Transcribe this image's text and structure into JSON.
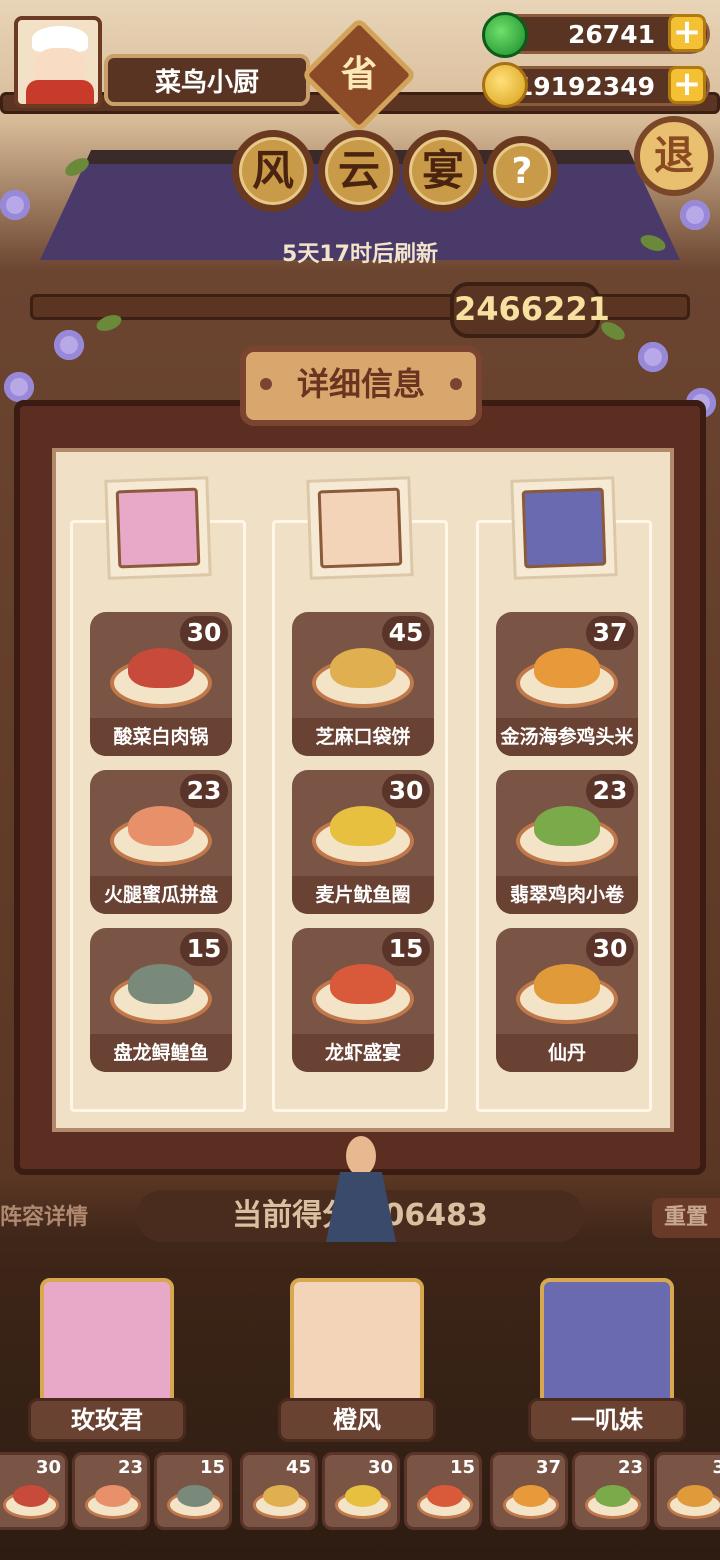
{
  "player": {
    "name": "菜鸟小厨",
    "badge": "省"
  },
  "resources": {
    "jade": "26741",
    "coins": "19192349"
  },
  "exit_label": "退",
  "event": {
    "title_chars": [
      "风",
      "云",
      "宴"
    ],
    "help": "?",
    "refresh_text": "5天17时后刷新",
    "top_score": "2466221"
  },
  "panel": {
    "header": "详细信息",
    "columns": [
      {
        "chef_color": "#e8a8c8",
        "dishes": [
          {
            "name": "酸菜白肉锅",
            "count": "30",
            "food": "#c84a3a"
          },
          {
            "name": "火腿蜜瓜拼盘",
            "count": "23",
            "food": "#e8906a"
          },
          {
            "name": "盘龙鲟鳇鱼",
            "count": "15",
            "food": "#7a8a7a"
          }
        ]
      },
      {
        "chef_color": "#f4d4b8",
        "dishes": [
          {
            "name": "芝麻口袋饼",
            "count": "45",
            "food": "#e0b050"
          },
          {
            "name": "麦片鱿鱼圈",
            "count": "30",
            "food": "#e8c040"
          },
          {
            "name": "龙虾盛宴",
            "count": "15",
            "food": "#d85a3a"
          }
        ]
      },
      {
        "chef_color": "#6a6ab0",
        "dishes": [
          {
            "name": "金汤海参鸡头米",
            "count": "37",
            "food": "#e89a3a"
          },
          {
            "name": "翡翠鸡肉小卷",
            "count": "23",
            "food": "#7aaa4a"
          },
          {
            "name": "仙丹",
            "count": "30",
            "food": "#e09a3a"
          }
        ]
      }
    ]
  },
  "bottom": {
    "current_score": "当前得分 306483",
    "lineup_label": "阵容详情",
    "reset_label": "重置",
    "chefs": [
      {
        "name": "玫玫君",
        "color": "#e8a8c8"
      },
      {
        "name": "橙风",
        "color": "#f4d4b8"
      },
      {
        "name": "一叽妹",
        "color": "#6a6ab0"
      }
    ],
    "mini_dishes": [
      {
        "count": "30",
        "food": "#c84a3a"
      },
      {
        "count": "23",
        "food": "#e8906a"
      },
      {
        "count": "15",
        "food": "#7a8a7a"
      },
      {
        "count": "45",
        "food": "#e0b050"
      },
      {
        "count": "30",
        "food": "#e8c040"
      },
      {
        "count": "15",
        "food": "#d85a3a"
      },
      {
        "count": "37",
        "food": "#e89a3a"
      },
      {
        "count": "23",
        "food": "#7aaa4a"
      },
      {
        "count": "3",
        "food": "#e09a3a"
      }
    ]
  }
}
